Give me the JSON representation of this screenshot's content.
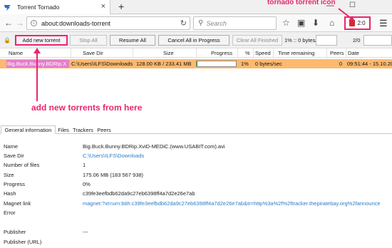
{
  "browser": {
    "tab_title": "Torrent Tornado",
    "new_tab": "+",
    "tab_close": "×",
    "min": "—",
    "max": "☐",
    "url": "about:downloads-torrent",
    "url_info": "i",
    "reload": "↻",
    "search_placeholder": "Search",
    "extension_count": "2:0",
    "icons": [
      "back-icon",
      "forward-icon",
      "reload-icon",
      "bookmark-star-icon",
      "clipboard-icon",
      "download-icon",
      "home-icon",
      "tornado-torrent-icon",
      "menu-icon"
    ]
  },
  "toolbar": {
    "add_new_torrent": "Add new torrent",
    "stop_all": "Stop All",
    "resume_all": "Resume All",
    "cancel_all": "Cancel All in Progress",
    "clear_finished": "Clear All Finished",
    "speed": "1% :: 0 bytes/sec",
    "ratio": "2/0"
  },
  "list": {
    "columns": [
      "Name",
      "Save Dir",
      "Size",
      "Progress",
      "%",
      "Speed",
      "Time remaining",
      "Peers",
      "Date"
    ],
    "rows": [
      {
        "name": "Big.Buck.Bunny.BDRip.X",
        "save_dir": "C:\\Users\\ILFS\\Downloads",
        "size": "128.00 KB / 233.41 MB",
        "progress": 0.01,
        "percent": "1%",
        "speed": "0 bytes/sec",
        "time_remaining": "",
        "peers": "0",
        "date": "09:51:44 - 15.10.20"
      }
    ]
  },
  "annotations": {
    "icon_label": "tornado torrent icon",
    "add_label": "add new torrents from here",
    "color": "#e8266e"
  },
  "bottom_tabs": [
    "General information",
    "Files",
    "Trackers",
    "Peers"
  ],
  "details": {
    "name_label": "Name",
    "name": "Big.Buck.Bunny.BDRip.XviD-MEDiC.(www.USABIT.com).avi",
    "savedir_label": "Save Dir",
    "savedir": "C:\\Users\\ILFS\\Downloads",
    "files_label": "Number of files",
    "files": "1",
    "size_label": "Size",
    "size": "175.06 MB (183 567 938)",
    "progress_label": "Progress",
    "progress": "0%",
    "hash_label": "Hash",
    "hash": "c39fe3eefbdb62da9c27eb6398ff4a7d2e26e7ab",
    "magnet_label": "Magnet link",
    "magnet": "magnet:?xt=urn:btih:c39fe3eefbdb62da9c27eb6398ff4a7d2e26e7ab&tr=http%3a%2f%2ftracker.thepiratebay.org%2fannounce",
    "error_label": "Error",
    "publisher_label": "Publisher",
    "publisher": "---",
    "publisher_url_label": "Publisher (URL)"
  }
}
